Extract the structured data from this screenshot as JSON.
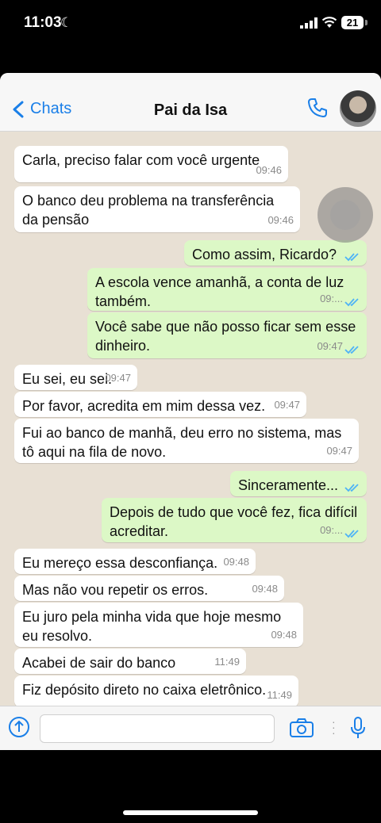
{
  "status_bar": {
    "time": "11:03",
    "battery": "21"
  },
  "header": {
    "back_label": "Chats",
    "title": "Pai da Isa"
  },
  "messages": [
    {
      "text": "Carla, preciso falar com você urgente",
      "time": "09:46"
    },
    {
      "text": "O banco deu problema na transferência da pensão",
      "time": "09:46"
    },
    {
      "text": "Como assim, Ricardo?",
      "time": ""
    },
    {
      "text": "A escola vence amanhã, a conta de luz também.",
      "time": "09:..."
    },
    {
      "text": "Você sabe que não posso ficar sem esse dinheiro.",
      "time": "09:47"
    },
    {
      "text": "Eu sei, eu sei.",
      "time": "09:47"
    },
    {
      "text": "Por favor, acredita em mim dessa vez.",
      "time": "09:47"
    },
    {
      "text": "Fui ao banco de manhã, deu erro no sistema, mas tô aqui na fila de novo.",
      "time": "09:47"
    },
    {
      "text": "Sinceramente...",
      "time": ""
    },
    {
      "text": "Depois de tudo que você fez, fica difícil acreditar.",
      "time": "09:..."
    },
    {
      "text": "Eu mereço essa desconfiança.",
      "time": "09:48"
    },
    {
      "text": "Mas não vou repetir os erros.",
      "time": "09:48"
    },
    {
      "text": "Eu juro pela minha vida que hoje mesmo eu resolvo.",
      "time": "09:48"
    },
    {
      "text": "Acabei de sair do banco",
      "time": "11:49"
    },
    {
      "text": "Fiz depósito direto no caixa eletrônico.",
      "time": "11:49"
    }
  ],
  "colors": {
    "accent": "#1a7fe8",
    "outgoing_bubble": "#dcf8c6",
    "incoming_bubble": "#ffffff",
    "chat_background": "#e8e0d4",
    "read_ticks": "#4fb3f6"
  },
  "icons": [
    "moon-icon",
    "signal-icon",
    "wifi-icon",
    "chevron-left-icon",
    "phone-icon",
    "plus-icon",
    "camera-icon",
    "microphone-icon",
    "double-check-icon"
  ]
}
